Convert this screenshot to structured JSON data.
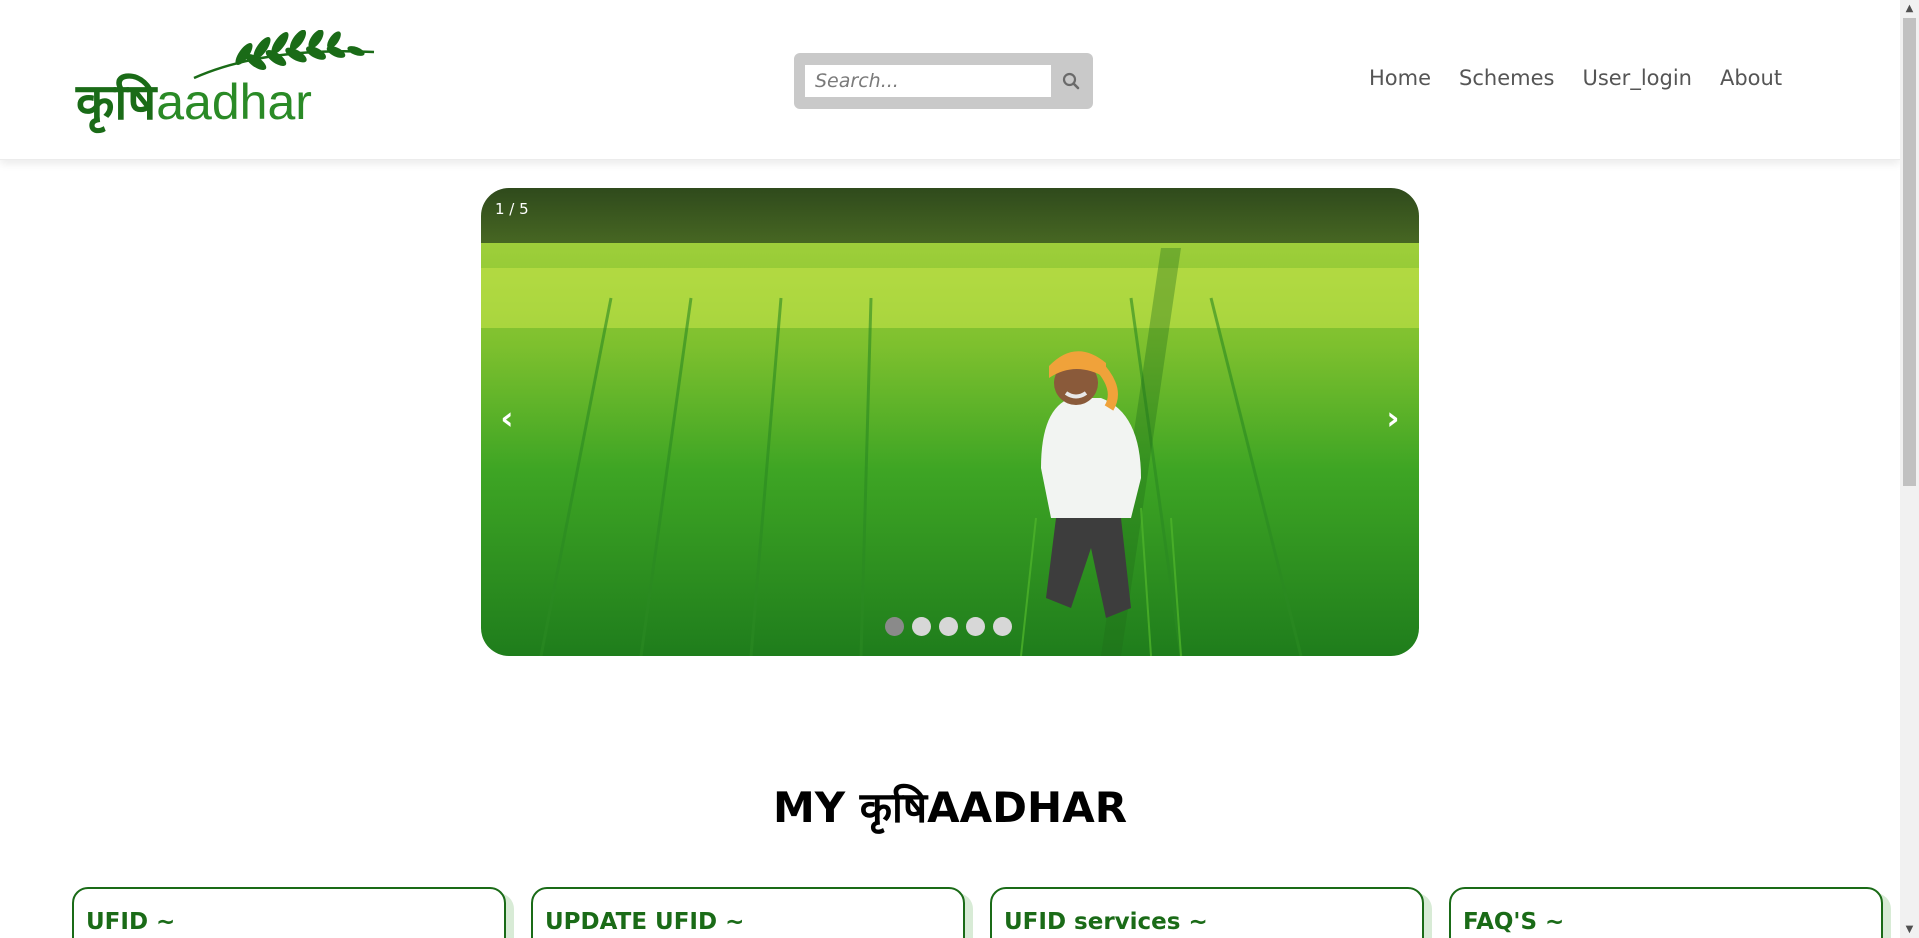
{
  "header": {
    "logo_hindi": "कृषि",
    "logo_latin": "aadhar",
    "search": {
      "placeholder": "Search..."
    },
    "nav": [
      "Home",
      "Schemes",
      "User_login",
      "About"
    ]
  },
  "carousel": {
    "counter": "1 / 5",
    "prev_label": "‹",
    "next_label": "›",
    "total_slides": 5,
    "active_slide": 1
  },
  "section": {
    "title": "MY कृषिAADHAR"
  },
  "cards": [
    "UFID ~",
    "UPDATE UFID ~",
    "UFID services ~",
    "FAQ'S ~"
  ],
  "colors": {
    "brand_green": "#1a6b17",
    "nav_text": "#555555",
    "search_frame": "#c9c9c9",
    "dot_active": "#8a8a8a",
    "dot_inactive": "#d7d7d7"
  },
  "icons": [
    "wheat-leaf-icon",
    "search-icon",
    "chevron-left-icon",
    "chevron-right-icon",
    "arrow-up-icon",
    "arrow-down-icon"
  ]
}
